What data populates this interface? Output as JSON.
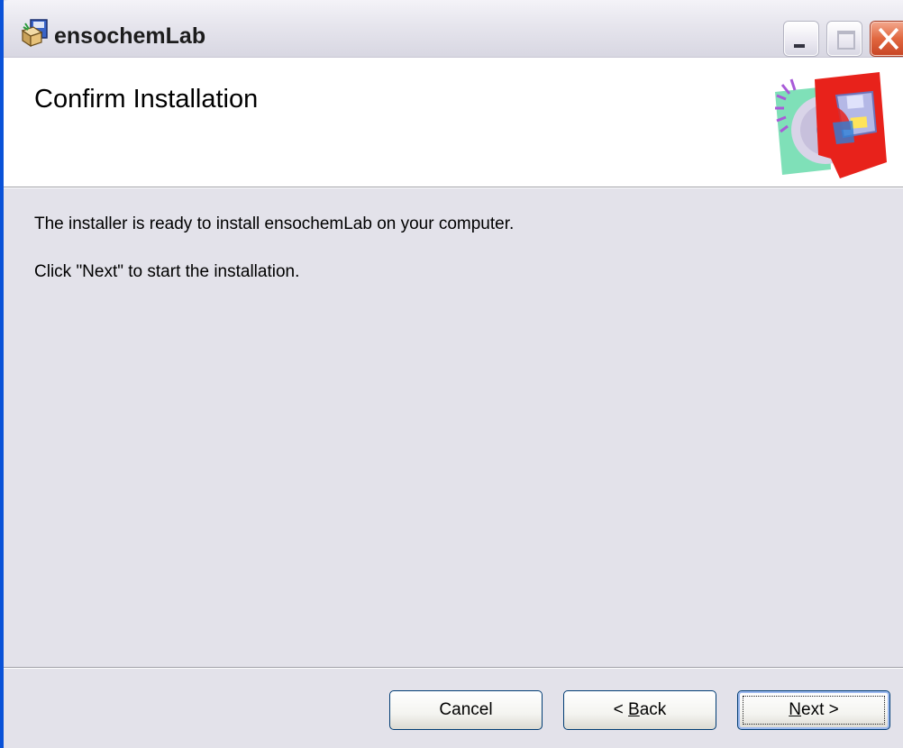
{
  "window": {
    "title": "ensochemLab",
    "controls": {
      "minimize_icon": "minimize-icon",
      "maximize_icon": "maximize-icon",
      "close_icon": "close-icon"
    }
  },
  "header": {
    "title": "Confirm Installation",
    "graphic_icon": "setup-cd-floppy-icon"
  },
  "body": {
    "line1": "The installer is ready to install ensochemLab on your computer.",
    "line2": "Click \"Next\" to start the installation."
  },
  "buttons": {
    "cancel": "Cancel",
    "back_prefix": "< ",
    "back_accel": "B",
    "back_rest": "ack",
    "next_accel": "N",
    "next_rest": "ext >"
  },
  "colors": {
    "frame_blue": "#0a52d8",
    "dialog_bg": "#e3e2ea",
    "close_red": "#e1673f"
  }
}
